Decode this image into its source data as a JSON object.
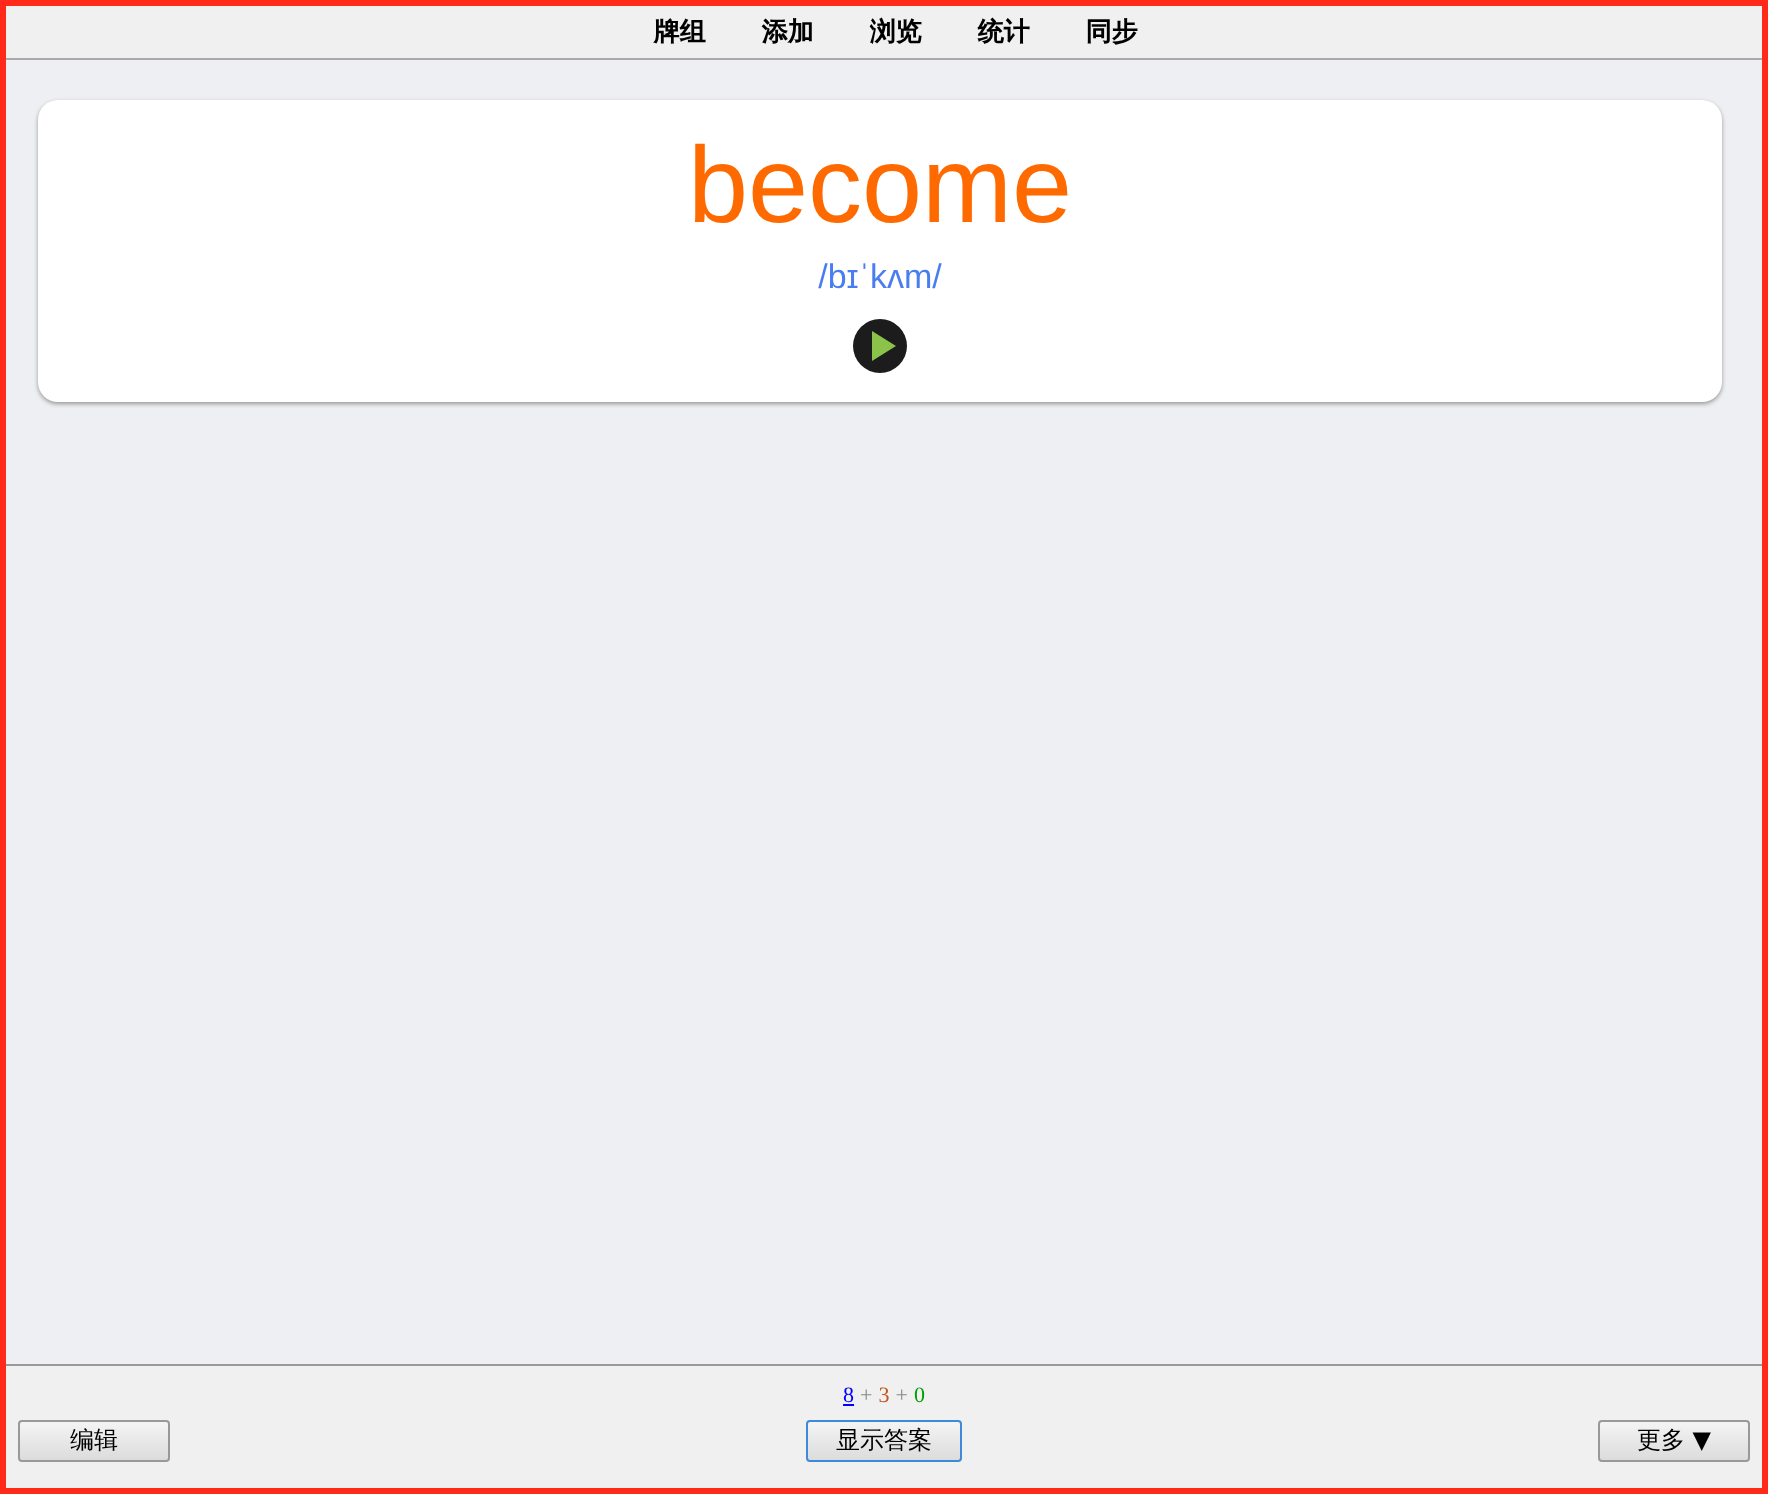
{
  "toolbar": {
    "items": [
      {
        "label": "牌组"
      },
      {
        "label": "添加"
      },
      {
        "label": "浏览"
      },
      {
        "label": "统计"
      },
      {
        "label": "同步"
      }
    ]
  },
  "card": {
    "word": "become",
    "phonetic": "/bɪˈkʌm/",
    "audio_button": {
      "kind": "play"
    }
  },
  "bottom_bar": {
    "counts": [
      {
        "text": "8",
        "color": "#0000ff",
        "selected": true
      },
      {
        "text": "3",
        "color": "#c35617",
        "selected": false
      },
      {
        "text": "0",
        "color": "#00a000",
        "selected": false
      }
    ],
    "separator": "+",
    "edit_button": "编辑",
    "answer_button": "显示答案",
    "more_button": "更多 ▼"
  }
}
